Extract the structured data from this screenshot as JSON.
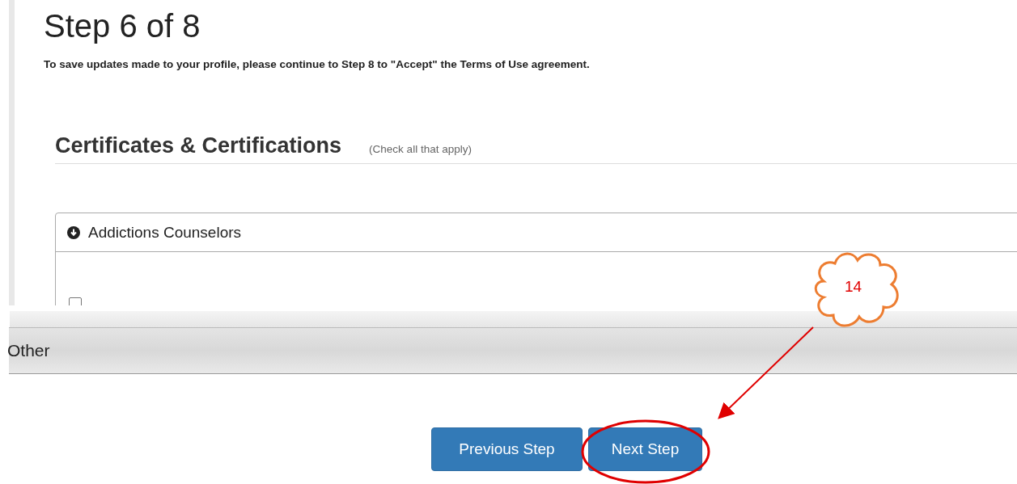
{
  "page": {
    "title": "Step 6 of 8",
    "notice": "To save updates made to your profile, please continue to Step 8 to \"Accept\" the Terms of Use agreement."
  },
  "section": {
    "title": "Certificates & Certifications",
    "hint": "(Check all that apply)"
  },
  "panel": {
    "title": "Addictions Counselors",
    "expanded": true,
    "checkbox": {
      "checked": false
    }
  },
  "other_bar": {
    "label": "Other"
  },
  "buttons": [
    {
      "label": "Previous Step"
    },
    {
      "label": "Next Step"
    }
  ],
  "annotation": {
    "number": "14"
  }
}
